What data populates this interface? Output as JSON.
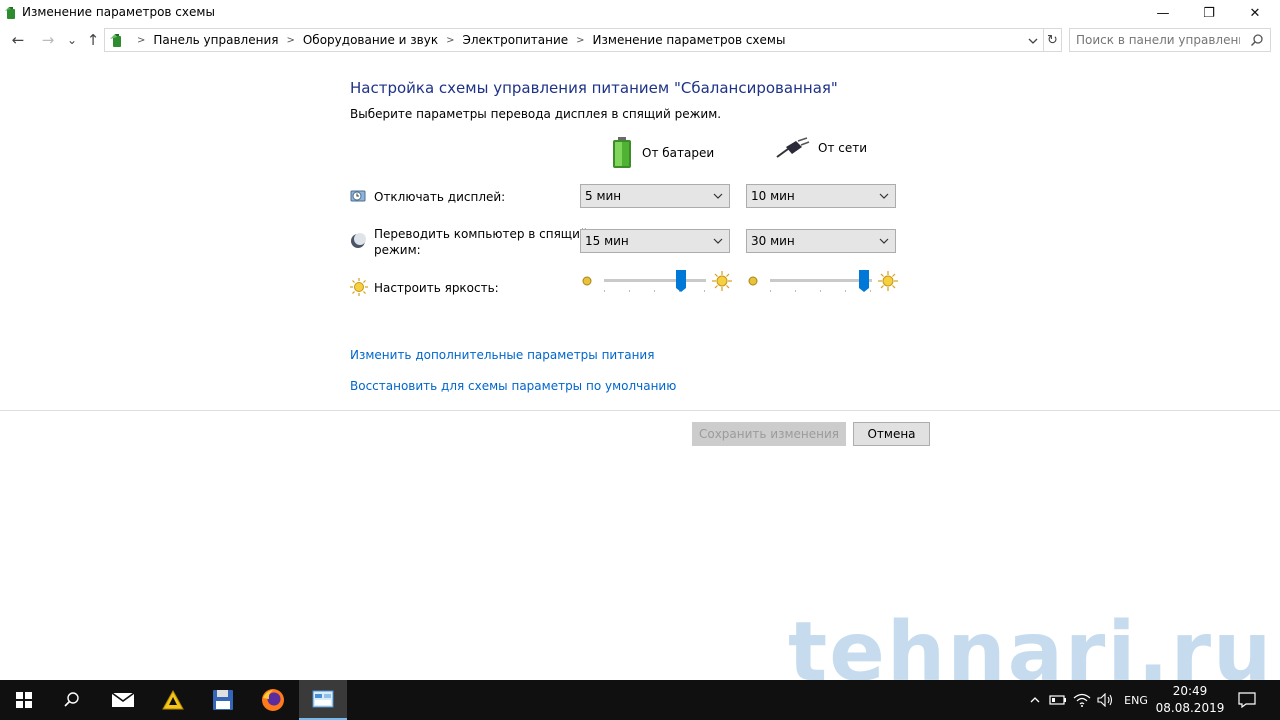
{
  "window": {
    "title": "Изменение параметров схемы",
    "minimize_glyph": "—",
    "maximize_glyph": "❐",
    "close_glyph": "✕"
  },
  "nav": {
    "back_glyph": "←",
    "forward_glyph": "→",
    "recent_glyph": "⌄",
    "up_glyph": "↑",
    "refresh_glyph": "↻",
    "breadcrumbs": [
      "Панель управления",
      "Оборудование и звук",
      "Электропитание",
      "Изменение параметров схемы"
    ],
    "search_placeholder": "Поиск в панели управления"
  },
  "content": {
    "heading": "Настройка схемы управления питанием \"Сбалансированная\"",
    "subtitle": "Выберите параметры перевода дисплея в спящий режим.",
    "columns": {
      "battery": "От батареи",
      "plugged": "От сети"
    },
    "rows": {
      "display_off": {
        "label": "Отключать дисплей:",
        "battery_value": "5 мин",
        "plugged_value": "10 мин"
      },
      "sleep": {
        "label_line1": "Переводить компьютер в спящий",
        "label_line2": "режим:",
        "battery_value": "15 мин",
        "plugged_value": "30 мин"
      },
      "brightness": {
        "label": "Настроить яркость:",
        "battery_level": 0.75,
        "plugged_level": 0.92
      }
    },
    "links": {
      "advanced": "Изменить дополнительные параметры питания",
      "restore": "Восстановить для схемы параметры по умолчанию"
    },
    "buttons": {
      "save": "Сохранить изменения",
      "cancel": "Отмена"
    }
  },
  "watermark": "tehnari.ru",
  "taskbar": {
    "language": "ENG",
    "time": "20:49",
    "date": "08.08.2019"
  },
  "colors": {
    "heading": "#1e3287",
    "link": "#0066cc",
    "slider_thumb": "#0078d7",
    "taskbar": "#101010"
  }
}
